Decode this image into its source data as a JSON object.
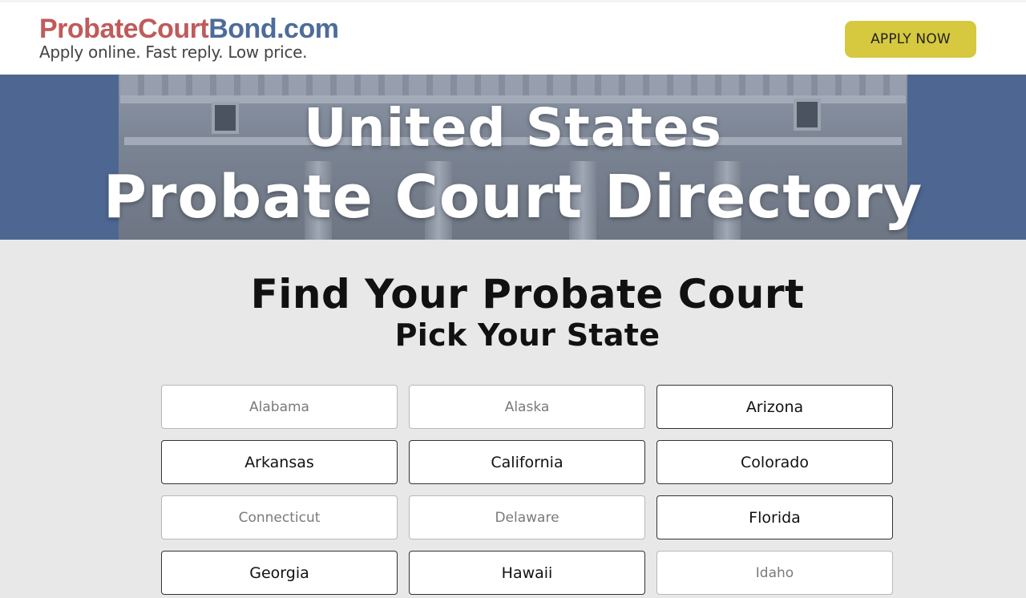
{
  "header": {
    "logo_part1": "ProbateCourt",
    "logo_part2": "Bond.com",
    "tagline": "Apply online. Fast reply. Low price.",
    "apply_label": "APPLY NOW"
  },
  "hero": {
    "title_line1": "United States",
    "title_line2": "Probate Court Directory"
  },
  "main": {
    "title": "Find Your Probate Court",
    "subtitle": "Pick Your State"
  },
  "states": [
    {
      "label": "Alabama",
      "active": false
    },
    {
      "label": "Alaska",
      "active": false
    },
    {
      "label": "Arizona",
      "active": true
    },
    {
      "label": "Arkansas",
      "active": true
    },
    {
      "label": "California",
      "active": true
    },
    {
      "label": "Colorado",
      "active": true
    },
    {
      "label": "Connecticut",
      "active": false
    },
    {
      "label": "Delaware",
      "active": false
    },
    {
      "label": "Florida",
      "active": true
    },
    {
      "label": "Georgia",
      "active": true
    },
    {
      "label": "Hawaii",
      "active": true
    },
    {
      "label": "Idaho",
      "active": false
    }
  ],
  "colors": {
    "logo_red": "#bf5b5b",
    "logo_blue": "#4d6c99",
    "apply_button": "#d6c83f",
    "hero_sky": "#4d6792",
    "page_background": "#e8e8e8"
  }
}
